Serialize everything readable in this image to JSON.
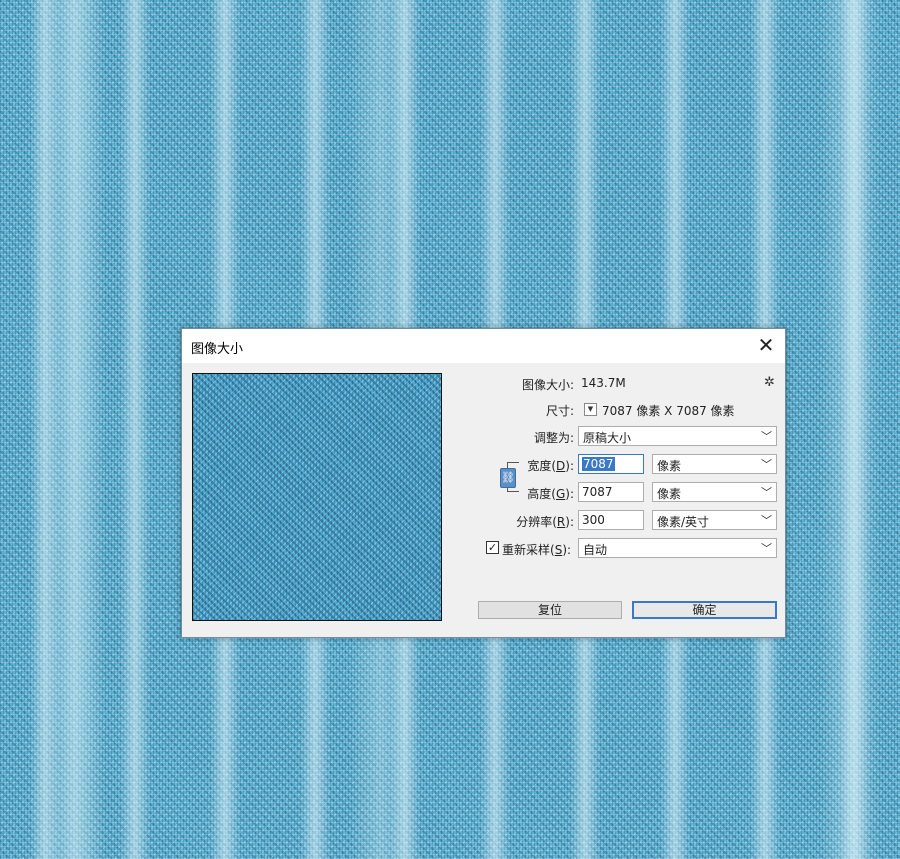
{
  "dialog": {
    "title": "图像大小",
    "close_glyph": "✕",
    "image_size_label": "图像大小:",
    "image_size_value": "143.7M",
    "dimensions_label": "尺寸:",
    "dimensions_value": "7087 像素  X  7087 像素",
    "fit_to_label": "调整为:",
    "fit_to_value": "原稿大小",
    "width_label_pre": "宽度(",
    "width_label_key": "D",
    "width_label_post": "):",
    "width_value": "7087",
    "width_unit": "像素",
    "height_label_pre": "高度(",
    "height_label_key": "G",
    "height_label_post": "):",
    "height_value": "7087",
    "height_unit": "像素",
    "resolution_label_pre": "分辨率(",
    "resolution_label_key": "R",
    "resolution_label_post": "):",
    "resolution_value": "300",
    "resolution_unit": "像素/英寸",
    "resample_label_pre": "重新采样(",
    "resample_label_key": "S",
    "resample_label_post": "):",
    "resample_checked": true,
    "resample_value": "自动",
    "reset_button": "复位",
    "ok_button": "确定"
  },
  "icons": {
    "gear": "gear-icon",
    "link": "link-icon",
    "chevron": "chevron-down-icon",
    "checkmark": "✓"
  },
  "colors": {
    "background": "#5ab1d2",
    "accent": "#3a78c8"
  }
}
